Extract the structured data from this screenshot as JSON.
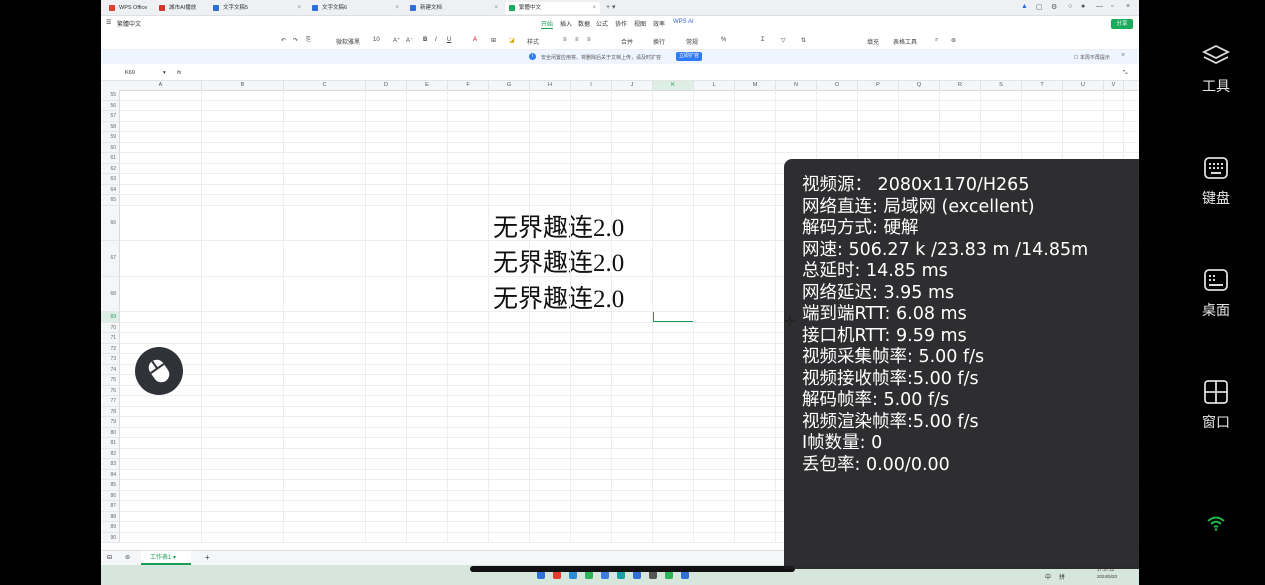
{
  "tabs": [
    {
      "label": "WPS Office",
      "color": "#e23d2b"
    },
    {
      "label": "城市AI播放",
      "color": "#d9342b"
    },
    {
      "label": "文字文稿5",
      "color": "#2f6fd8"
    },
    {
      "label": "文字文稿6",
      "color": "#2f6fd8"
    },
    {
      "label": "新建文档",
      "color": "#2f6fd8"
    },
    {
      "label": "繁體中文",
      "color": "#1aab5c"
    }
  ],
  "menu": {
    "file_label": "繁體中文",
    "items": [
      "开始",
      "插入",
      "数据",
      "公式",
      "协作",
      "视图",
      "效率",
      "WPS AI"
    ],
    "share": "分享"
  },
  "toolbar": {
    "font": "微软雅黑",
    "size": "10",
    "style": "样式",
    "merge": "合并",
    "wrap": "换行",
    "number_format": "常规",
    "fill": "填充",
    "tools": "表格工具"
  },
  "notice": {
    "message": "安全闲置应用将、将删除后关于文档上传，请及时扩容",
    "button": "立即扩容",
    "no_remind": "本周不再提示"
  },
  "formula_bar": {
    "cell_ref": "K69",
    "fx": "fx"
  },
  "columns": [
    "A",
    "B",
    "C",
    "D",
    "E",
    "F",
    "G",
    "H",
    "I",
    "J",
    "K",
    "L",
    "M",
    "N",
    "O",
    "P",
    "Q",
    "R",
    "S",
    "T",
    "U",
    "V"
  ],
  "rows": [
    "55",
    "56",
    "57",
    "58",
    "59",
    "60",
    "61",
    "62",
    "63",
    "64",
    "65",
    "66",
    "67",
    "68",
    "69",
    "70",
    "71",
    "72",
    "73",
    "74",
    "75",
    "76",
    "77",
    "78",
    "79",
    "80",
    "81",
    "82",
    "83",
    "84",
    "85",
    "86",
    "87",
    "88",
    "89",
    "90"
  ],
  "cells": [
    "无界趣连2.0",
    "无界趣连2.0",
    "无界趣连2.0"
  ],
  "sheet": {
    "tab_label": "工作表1",
    "add": "+"
  },
  "taskbar": {
    "time": "17:37:11",
    "date": "2024/5/20",
    "lang": "中",
    "ime": "拼"
  },
  "overlay": [
    "视频源：  2080x1170/H265",
    "网络直连: 局域网 (excellent)",
    "解码方式: 硬解",
    "网速: 506.27 k /23.83 m /14.85m",
    "总延时: 14.85 ms",
    "网络延迟: 3.95 ms",
    "端到端RTT: 6.08 ms",
    "接口机RTT: 9.59 ms",
    "视频采集帧率: 5.00 f/s",
    "视频接收帧率:5.00 f/s",
    "解码帧率: 5.00 f/s",
    "视频渲染帧率:5.00 f/s",
    "I帧数量: 0",
    "丢包率: 0.00/0.00"
  ],
  "side_panel": [
    {
      "label": "工具",
      "icon": "layers-icon"
    },
    {
      "label": "键盘",
      "icon": "keyboard-icon"
    },
    {
      "label": "桌面",
      "icon": "desktop-icon"
    },
    {
      "label": "窗口",
      "icon": "window-grid-icon"
    }
  ],
  "colors": {
    "accent": "#1a9e57",
    "wifi": "#1fb84a",
    "overlay_bg": "#1c1c1e"
  }
}
